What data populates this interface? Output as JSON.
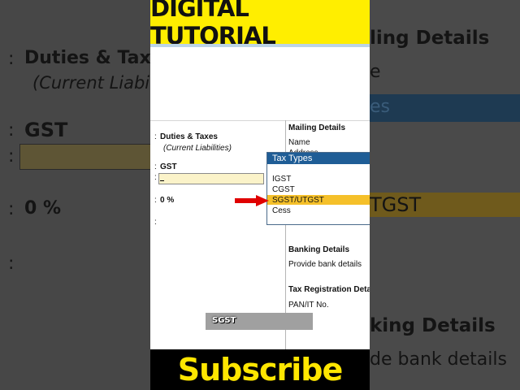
{
  "banner": {
    "title": "DIGITAL TUTORIAL"
  },
  "subscribe": {
    "label": "Subscribe"
  },
  "left": {
    "colon": ":",
    "group": "Duties & Taxes",
    "subgroup": "(Current Liabilities)",
    "name_label": "GST",
    "rate": "0 %"
  },
  "right": {
    "mailing_header": "Mailing Details",
    "name": "Name",
    "address": "Address",
    "banking_header": "Banking Details",
    "provide_bank": "Provide bank details",
    "taxreg_header": "Tax Registration Details",
    "pan": "PAN/IT No."
  },
  "dropdown": {
    "title": "Tax Types",
    "items": [
      "IGST",
      "CGST",
      "SGST/UTGST",
      "Cess"
    ],
    "selected": "SGST/UTGST"
  },
  "caption": {
    "text": "SGST"
  },
  "bg": {
    "duties": "Duties & Taxes",
    "liab": "(Current Liabi",
    "gst": "GST",
    "rate": "0 %",
    "mailing": "ling Details",
    "name_frag": "e",
    "types_frag": "es",
    "tgst_frag": "TGST",
    "banking": "king Details",
    "bank_details": "de bank details"
  },
  "colors": {
    "banner": "#ffee00",
    "accent": "#1f5d96",
    "highlight": "#f5c02a",
    "arrow": "#e00000"
  }
}
